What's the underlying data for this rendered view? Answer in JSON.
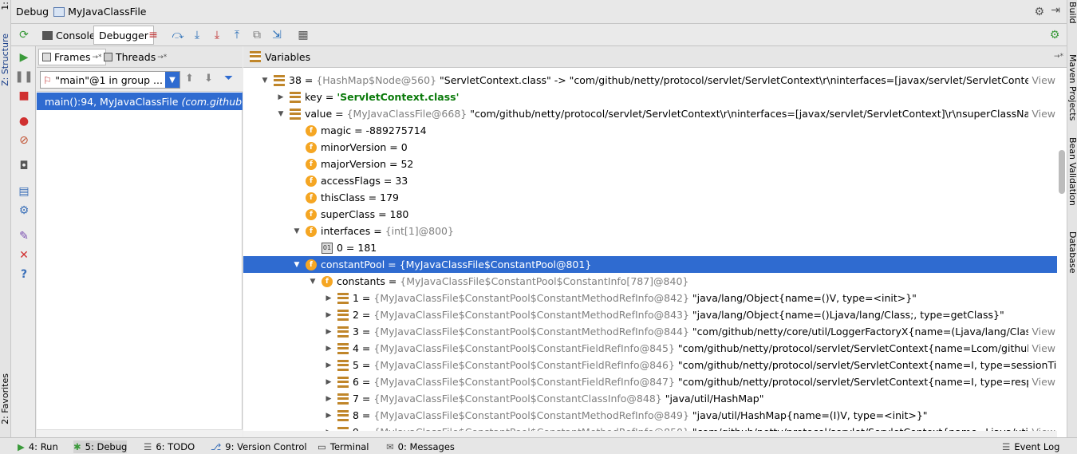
{
  "window": {
    "title_prefix": "Debug",
    "config_name": "MyJavaClassFile"
  },
  "left_stripe": {
    "top_item": "1:",
    "structure": "Z: Structure",
    "favorites": "2: Favorites"
  },
  "right_stripe": {
    "build": "Build",
    "maven": "Maven Projects",
    "bean": "Bean Validation",
    "database": "Database"
  },
  "toolbar": {
    "console_tab": "Console",
    "debugger_tab": "Debugger"
  },
  "frames": {
    "tab_frames": "Frames",
    "tab_frames_pin": "→*",
    "tab_threads": "Threads",
    "tab_threads_pin": "→*",
    "thread_combo": "\"main\"@1 in group ...",
    "selected_frame_main": "main():94, MyJavaClassFile",
    "selected_frame_pkg": "(com.github.netty"
  },
  "variables": {
    "header": "Variables",
    "pin": "→*",
    "view_label": "View",
    "rows": [
      {
        "indent": 0,
        "toggle": "▼",
        "icon": "entry",
        "name": "38",
        "sep": " = ",
        "addr": "{HashMap$Node@560}",
        "value": " \"ServletContext.class\" -> \"com/github/netty/protocol/servlet/ServletContext\\r\\ninterfaces=[javax/servlet/ServletContext]\\r\\nsup...",
        "view": true
      },
      {
        "indent": 1,
        "toggle": "▶",
        "icon": "entry",
        "name": "key",
        "sep": " = ",
        "addr": "",
        "value": "'ServletContext.class'",
        "value_style": "key",
        "view": false
      },
      {
        "indent": 1,
        "toggle": "▼",
        "icon": "entry",
        "name": "value",
        "sep": " = ",
        "addr": "{MyJavaClassFile@668}",
        "value": " \"com/github/netty/protocol/servlet/ServletContext\\r\\ninterfaces=[javax/servlet/ServletContext]\\r\\nsuperClassName=java/...",
        "view": true
      },
      {
        "indent": 2,
        "toggle": "",
        "icon": "field",
        "name": "magic",
        "sep": " = ",
        "addr": "",
        "value": "-889275714",
        "view": false
      },
      {
        "indent": 2,
        "toggle": "",
        "icon": "field",
        "name": "minorVersion",
        "sep": " = ",
        "addr": "",
        "value": "0",
        "view": false
      },
      {
        "indent": 2,
        "toggle": "",
        "icon": "field",
        "name": "majorVersion",
        "sep": " = ",
        "addr": "",
        "value": "52",
        "view": false
      },
      {
        "indent": 2,
        "toggle": "",
        "icon": "field",
        "name": "accessFlags",
        "sep": " = ",
        "addr": "",
        "value": "33",
        "view": false
      },
      {
        "indent": 2,
        "toggle": "",
        "icon": "field",
        "name": "thisClass",
        "sep": " = ",
        "addr": "",
        "value": "179",
        "view": false
      },
      {
        "indent": 2,
        "toggle": "",
        "icon": "field",
        "name": "superClass",
        "sep": " = ",
        "addr": "",
        "value": "180",
        "view": false
      },
      {
        "indent": 2,
        "toggle": "▼",
        "icon": "field",
        "name": "interfaces",
        "sep": " = ",
        "addr": "{int[1]@800}",
        "value": "",
        "view": false
      },
      {
        "indent": 3,
        "toggle": "",
        "icon": "array",
        "name": "0",
        "sep": " = ",
        "addr": "",
        "value": "181",
        "view": false
      },
      {
        "indent": 2,
        "toggle": "▼",
        "icon": "field",
        "name": "constantPool",
        "sep": " = ",
        "addr": "{MyJavaClassFile$ConstantPool@801}",
        "value": "",
        "view": false,
        "selected": true
      },
      {
        "indent": 3,
        "toggle": "▼",
        "icon": "field",
        "name": "constants",
        "sep": " = ",
        "addr": "{MyJavaClassFile$ConstantPool$ConstantInfo[787]@840}",
        "value": "",
        "view": false
      },
      {
        "indent": 4,
        "toggle": "▶",
        "icon": "entry",
        "name": "1",
        "sep": " = ",
        "addr": "{MyJavaClassFile$ConstantPool$ConstantMethodRefInfo@842}",
        "value": " \"java/lang/Object{name=()V, type=<init>}\"",
        "view": false
      },
      {
        "indent": 4,
        "toggle": "▶",
        "icon": "entry",
        "name": "2",
        "sep": " = ",
        "addr": "{MyJavaClassFile$ConstantPool$ConstantMethodRefInfo@843}",
        "value": " \"java/lang/Object{name=()Ljava/lang/Class;, type=getClass}\"",
        "view": false
      },
      {
        "indent": 4,
        "toggle": "▶",
        "icon": "entry",
        "name": "3",
        "sep": " = ",
        "addr": "{MyJavaClassFile$ConstantPool$ConstantMethodRefInfo@844}",
        "value": " \"com/github/netty/core/util/LoggerFactoryX{name=(Ljava/lang/Class;)Lcom/...",
        "view": true
      },
      {
        "indent": 4,
        "toggle": "▶",
        "icon": "entry",
        "name": "4",
        "sep": " = ",
        "addr": "{MyJavaClassFile$ConstantPool$ConstantFieldRefInfo@845}",
        "value": " \"com/github/netty/protocol/servlet/ServletContext{name=Lcom/github/netty/co...",
        "view": true
      },
      {
        "indent": 4,
        "toggle": "▶",
        "icon": "entry",
        "name": "5",
        "sep": " = ",
        "addr": "{MyJavaClassFile$ConstantPool$ConstantFieldRefInfo@846}",
        "value": " \"com/github/netty/protocol/servlet/ServletContext{name=I, type=sessionTimeout}\"",
        "view": false
      },
      {
        "indent": 4,
        "toggle": "▶",
        "icon": "entry",
        "name": "6",
        "sep": " = ",
        "addr": "{MyJavaClassFile$ConstantPool$ConstantFieldRefInfo@847}",
        "value": " \"com/github/netty/protocol/servlet/ServletContext{name=I, type=responseWrite...",
        "view": true
      },
      {
        "indent": 4,
        "toggle": "▶",
        "icon": "entry",
        "name": "7",
        "sep": " = ",
        "addr": "{MyJavaClassFile$ConstantPool$ConstantClassInfo@848}",
        "value": " \"java/util/HashMap\"",
        "view": false
      },
      {
        "indent": 4,
        "toggle": "▶",
        "icon": "entry",
        "name": "8",
        "sep": " = ",
        "addr": "{MyJavaClassFile$ConstantPool$ConstantMethodRefInfo@849}",
        "value": " \"java/util/HashMap{name=(I)V, type=<init>}\"",
        "view": false
      },
      {
        "indent": 4,
        "toggle": "▶",
        "icon": "entry",
        "name": "9",
        "sep": " = ",
        "addr": "{MyJavaClassFile$ConstantPool$ConstantMethodRefInfo@850}",
        "value": " \"com/github/netty/protocol/servlet/ServletContext{name=Ljava/util/Map;, type=...",
        "view": true
      }
    ]
  },
  "bottom_bar": {
    "tabs": [
      "4: Run",
      "5: Debug",
      "6: TODO",
      "9: Version Control",
      "Terminal",
      "0: Messages"
    ],
    "right": "Event Log"
  },
  "colors": {
    "selection": "#2f6bd0",
    "address_gray": "#808080",
    "string_green": "#0a7a0a",
    "field_icon": "#f5a623"
  }
}
